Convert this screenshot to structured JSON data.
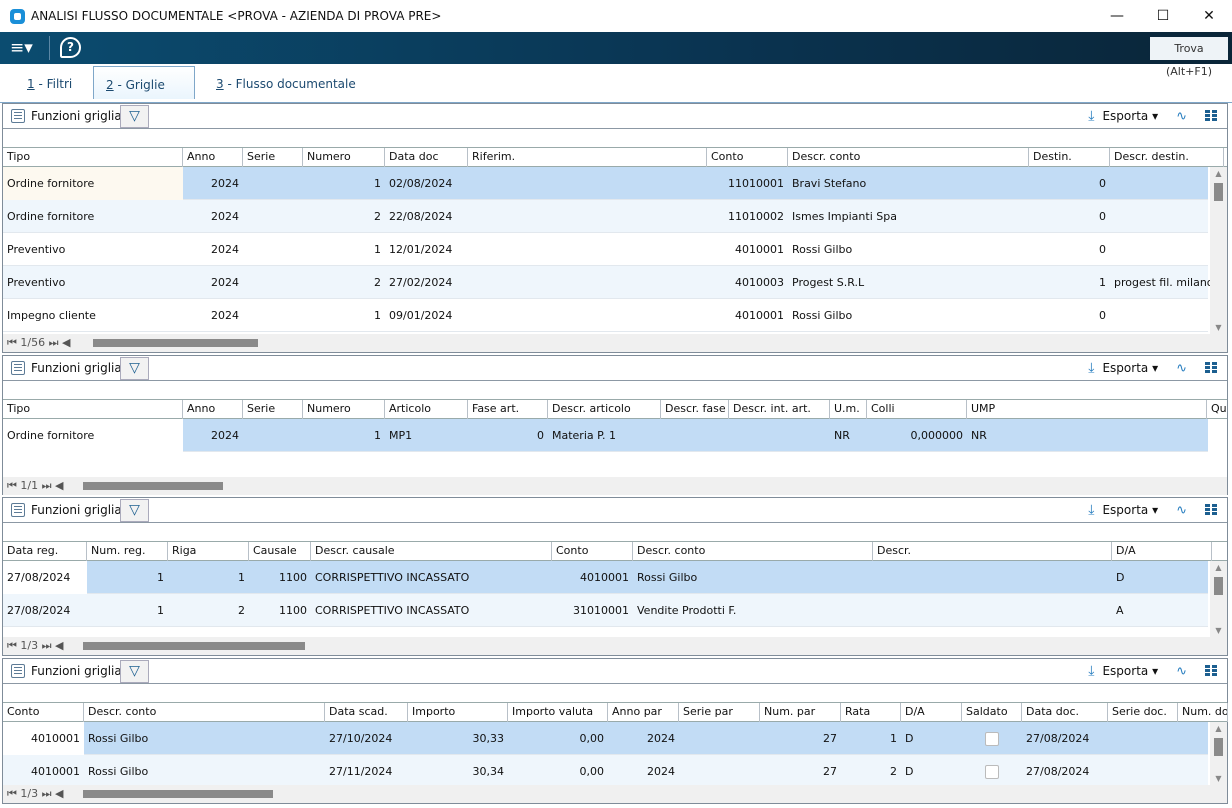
{
  "window": {
    "title": "ANALISI FLUSSO DOCUMENTALE <PROVA - AZIENDA DI PROVA PRE>",
    "minimize": "—",
    "maximize": "☐",
    "close": "✕"
  },
  "toolbar": {
    "menu": "≡▾",
    "help": "?",
    "search_placeholder": "Trova (Alt+F1)"
  },
  "tabs": [
    {
      "key": "1",
      "label": " - Filtri"
    },
    {
      "key": "2",
      "label": " - Griglie",
      "active": true
    },
    {
      "key": "3",
      "label": " - Flusso documentale"
    }
  ],
  "panel_toolbar": {
    "functions_label": "Funzioni griglia",
    "export_label": "Esporta ▾"
  },
  "grids": [
    {
      "headers": [
        "Tipo",
        "Anno",
        "Serie",
        "Numero",
        "Data doc",
        "Riferim.",
        "Conto",
        "Descr. conto",
        "Destin.",
        "Descr. destin."
      ],
      "rows": [
        [
          "Ordine fornitore",
          "2024",
          "",
          "1",
          "02/08/2024",
          "",
          "11010001",
          "Bravi Stefano",
          "0",
          ""
        ],
        [
          "Ordine fornitore",
          "2024",
          "",
          "2",
          "22/08/2024",
          "",
          "11010002",
          "Ismes Impianti Spa",
          "0",
          ""
        ],
        [
          "Preventivo",
          "2024",
          "",
          "1",
          "12/01/2024",
          "",
          "4010001",
          "Rossi Gilbo",
          "0",
          ""
        ],
        [
          "Preventivo",
          "2024",
          "",
          "2",
          "27/02/2024",
          "",
          "4010003",
          "Progest S.R.L",
          "1",
          "progest fil. milano"
        ],
        [
          "Impegno cliente",
          "2024",
          "",
          "1",
          "09/01/2024",
          "",
          "4010001",
          "Rossi Gilbo",
          "0",
          ""
        ]
      ],
      "pager": "1/56"
    },
    {
      "headers": [
        "Tipo",
        "Anno",
        "Serie",
        "Numero",
        "Articolo",
        "Fase art.",
        "Descr. articolo",
        "Descr. fase",
        "Descr. int. art.",
        "U.m.",
        "Colli",
        "UMP",
        "Qu"
      ],
      "rows": [
        [
          "Ordine fornitore",
          "2024",
          "",
          "1",
          "MP1",
          "0",
          "Materia P. 1",
          "",
          "",
          "NR",
          "0,000000",
          "NR",
          ""
        ]
      ],
      "pager": "1/1"
    },
    {
      "headers": [
        "Data reg.",
        "Num. reg.",
        "Riga",
        "Causale",
        "Descr. causale",
        "Conto",
        "Descr. conto",
        "Descr.",
        "D/A"
      ],
      "rows": [
        [
          "27/08/2024",
          "1",
          "1",
          "1100",
          "CORRISPETTIVO INCASSATO",
          "4010001",
          "Rossi Gilbo",
          "",
          "D"
        ],
        [
          "27/08/2024",
          "1",
          "2",
          "1100",
          "CORRISPETTIVO INCASSATO",
          "31010001",
          "Vendite Prodotti F.",
          "",
          "A"
        ]
      ],
      "pager": "1/3"
    },
    {
      "headers": [
        "Conto",
        "Descr. conto",
        "Data scad.",
        "Importo",
        "Importo valuta",
        "Anno par",
        "Serie par",
        "Num. par",
        "Rata",
        "D/A",
        "Saldato",
        "Data doc.",
        "Serie doc.",
        "Num. do"
      ],
      "rows": [
        [
          "4010001",
          "Rossi Gilbo",
          "27/10/2024",
          "30,33",
          "0,00",
          "2024",
          "",
          "27",
          "1",
          "D",
          "",
          "27/08/2024",
          "",
          ""
        ],
        [
          "4010001",
          "Rossi Gilbo",
          "27/11/2024",
          "30,34",
          "0,00",
          "2024",
          "",
          "27",
          "2",
          "D",
          "",
          "27/08/2024",
          "",
          ""
        ]
      ],
      "pager": "1/3"
    }
  ]
}
